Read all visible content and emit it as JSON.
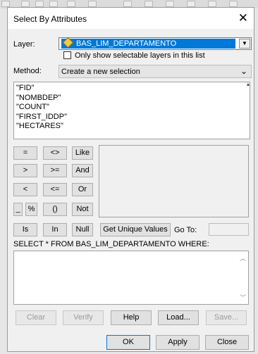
{
  "dialog": {
    "title": "Select By Attributes",
    "close_icon": "close-icon"
  },
  "layer": {
    "label": "Layer:",
    "value": "BAS_LIM_DEPARTAMENTO",
    "icon": "layer-icon",
    "checkbox_label": "Only show selectable layers in this list",
    "checkbox_checked": false
  },
  "method": {
    "label": "Method:",
    "value": "Create a new selection"
  },
  "fields": [
    "\"FID\"",
    "\"NOMBDEP\"",
    "\"COUNT\"",
    "\"FIRST_IDDP\"",
    "\"HECTARES\""
  ],
  "operators": {
    "eq": "=",
    "neq": "<>",
    "like": "Like",
    "gt": ">",
    "gte": ">=",
    "and": "And",
    "lt": "<",
    "lte": "<=",
    "or": "Or",
    "underscore": "_",
    "percent": "%",
    "parens": "()",
    "not": "Not",
    "is": "Is",
    "in": "In",
    "null": "Null"
  },
  "get_unique_values": "Get Unique Values",
  "goto_label": "Go To:",
  "sql_prefix": "SELECT * FROM BAS_LIM_DEPARTAMENTO WHERE:",
  "buttons": {
    "clear": "Clear",
    "verify": "Verify",
    "help": "Help",
    "load": "Load...",
    "save": "Save...",
    "ok": "OK",
    "apply": "Apply",
    "close": "Close"
  },
  "colors": {
    "selection": "#0078d7",
    "dialog_bg": "#f0f0f0",
    "disabled_text": "#9a9a9a"
  }
}
